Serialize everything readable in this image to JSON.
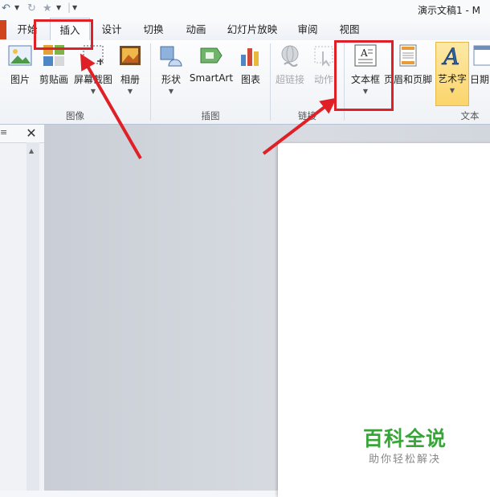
{
  "window": {
    "title": "演示文稿1 - M"
  },
  "quick_access": {
    "undo_icon": "undo-icon",
    "redo_icon": "redo-icon",
    "star_icon": "star-icon",
    "customize_icon": "customize-dropdown-icon"
  },
  "tabs": [
    {
      "label": "开始",
      "active": false
    },
    {
      "label": "插入",
      "active": true
    },
    {
      "label": "设计",
      "active": false
    },
    {
      "label": "切换",
      "active": false
    },
    {
      "label": "动画",
      "active": false
    },
    {
      "label": "幻灯片放映",
      "active": false
    },
    {
      "label": "审阅",
      "active": false
    },
    {
      "label": "视图",
      "active": false
    }
  ],
  "ribbon": {
    "buttons": {
      "picture": "图片",
      "clipart": "剪贴画",
      "screenshot": "屏幕截图",
      "album": "相册",
      "shapes": "形状",
      "smartart": "SmartArt",
      "chart": "图表",
      "hyperlink": "超链接",
      "action": "动作",
      "textbox": "文本框",
      "header_footer": "页眉和页脚",
      "wordart": "艺术字",
      "datetime": "日期"
    },
    "groups": {
      "images": "图像",
      "illustrations": "插图",
      "links": "链接",
      "text": "文本"
    }
  },
  "panel": {
    "close_label": "✕",
    "menu_glyph": "≡"
  },
  "watermark": {
    "title": "百科全说",
    "subtitle": "助你轻松解决"
  },
  "colors": {
    "highlight": "#e02027",
    "file_tab": "#d0451b",
    "watermark": "#37a537"
  }
}
